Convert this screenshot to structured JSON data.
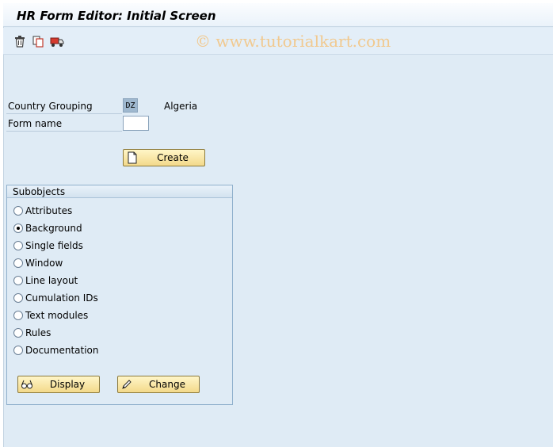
{
  "window": {
    "title": "HR Form Editor: Initial Screen"
  },
  "toolbar": {
    "icons": [
      "delete-icon",
      "copy-icon",
      "transport-icon"
    ]
  },
  "watermark": "© www.tutorialkart.com",
  "form": {
    "country_grouping_label": "Country Grouping",
    "country_grouping_value": "DZ",
    "country_name": "Algeria",
    "form_name_label": "Form name",
    "form_name_value": ""
  },
  "buttons": {
    "create": "Create",
    "display": "Display",
    "change": "Change"
  },
  "subobjects": {
    "title": "Subobjects",
    "options": [
      {
        "label": "Attributes",
        "selected": false
      },
      {
        "label": "Background",
        "selected": true
      },
      {
        "label": "Single fields",
        "selected": false
      },
      {
        "label": "Window",
        "selected": false
      },
      {
        "label": "Line layout",
        "selected": false
      },
      {
        "label": "Cumulation IDs",
        "selected": false
      },
      {
        "label": "Text modules",
        "selected": false
      },
      {
        "label": "Rules",
        "selected": false
      },
      {
        "label": "Documentation",
        "selected": false
      }
    ]
  },
  "colors": {
    "background": "#dfebf5",
    "button": "#f7e3a0",
    "watermark": "#f1c98f"
  }
}
